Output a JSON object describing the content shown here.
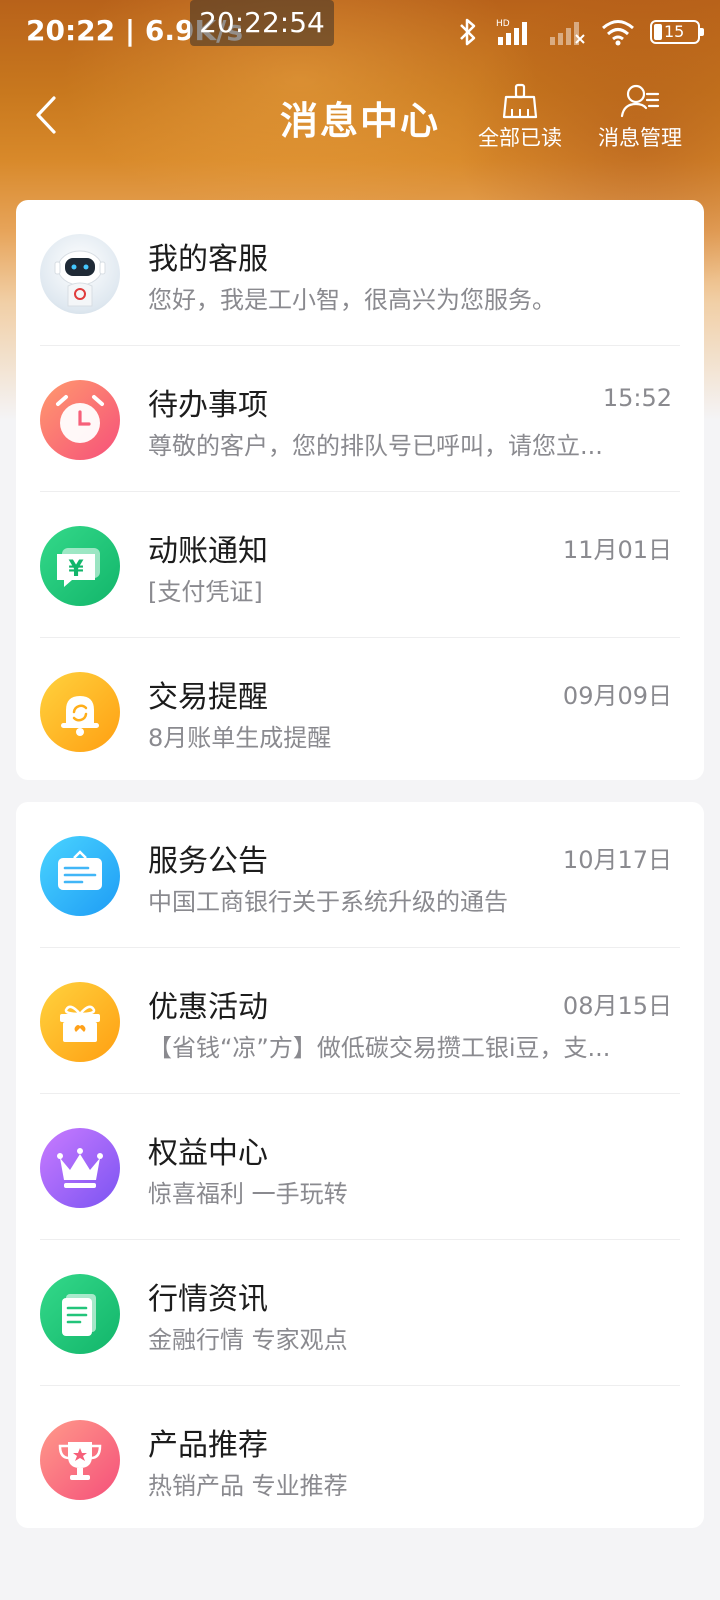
{
  "status_bar": {
    "time": "20:22 | 6.9K/s",
    "clock": "20:22:54",
    "battery": "15"
  },
  "nav": {
    "title": "消息中心",
    "mark_all_read": "全部已读",
    "manage": "消息管理"
  },
  "groups": [
    [
      {
        "name": "我的客服",
        "desc": "您好，我是工小智，很高兴为您服务。",
        "time": "",
        "icon": "robot-avatar-icon"
      },
      {
        "name": "待办事项",
        "desc": "尊敬的客户，您的排队号已呼叫，请您立...",
        "time": "15:52",
        "icon": "alarm-clock-icon"
      },
      {
        "name": "动账通知",
        "desc": "[支付凭证]",
        "time": "11月01日",
        "icon": "yuan-message-icon"
      },
      {
        "name": "交易提醒",
        "desc": "8月账单生成提醒",
        "time": "09月09日",
        "icon": "bell-icon"
      }
    ],
    [
      {
        "name": "服务公告",
        "desc": "中国工商银行关于系统升级的通告",
        "time": "10月17日",
        "icon": "notice-board-icon"
      },
      {
        "name": "优惠活动",
        "desc": "【省钱“凉”方】做低碳交易攒工银i豆，支...",
        "time": "08月15日",
        "icon": "gift-box-icon"
      },
      {
        "name": "权益中心",
        "desc": "惊喜福利 一手玩转",
        "time": "",
        "icon": "crown-icon"
      },
      {
        "name": "行情资讯",
        "desc": "金融行情 专家观点",
        "time": "",
        "icon": "document-icon"
      },
      {
        "name": "产品推荐",
        "desc": "热销产品 专业推荐",
        "time": "",
        "icon": "trophy-icon"
      }
    ]
  ],
  "colors": {
    "accent": "#d8892a",
    "text": "#1c1c1c",
    "muted": "#8a8a8f"
  }
}
